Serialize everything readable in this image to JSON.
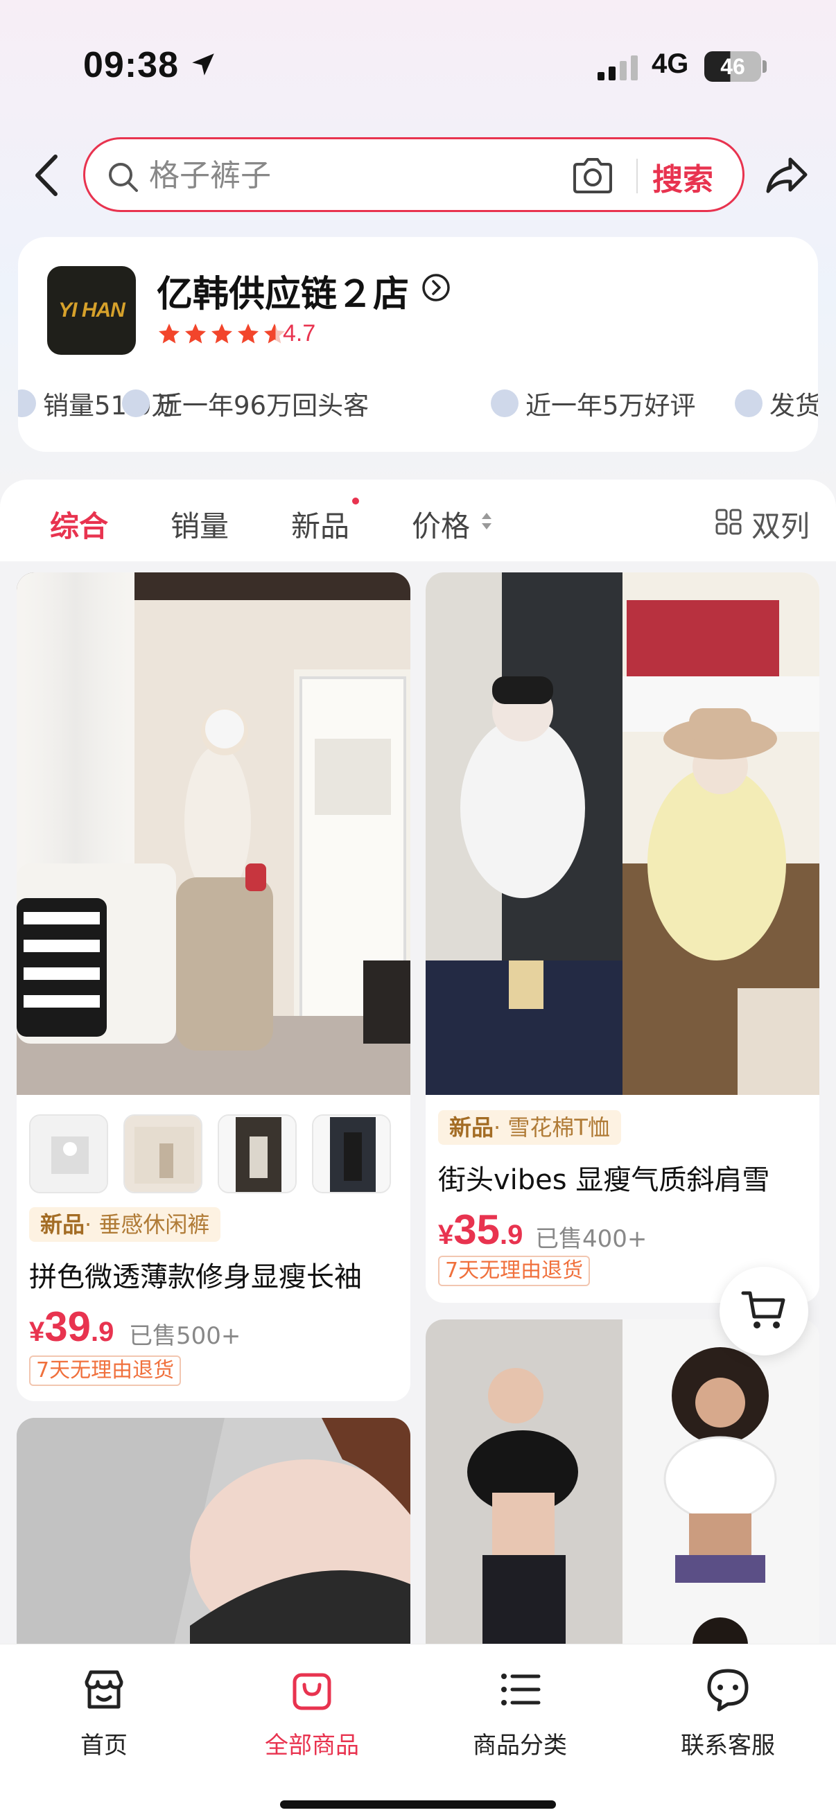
{
  "status_bar": {
    "time": "09:38",
    "network": "4G",
    "battery": "46"
  },
  "search": {
    "placeholder": "格子裤子",
    "button_label": "搜索"
  },
  "store": {
    "logo_text": "YI HAN",
    "name": "亿韩供应链２店",
    "rating": "4.7",
    "stats": [
      "销量51.0万",
      "近一年96万回头客",
      "近一年5万好评",
      "发货"
    ]
  },
  "tabs": {
    "items": [
      "综合",
      "销量",
      "新品",
      "价格"
    ],
    "active_index": 0,
    "layout_toggle": "双列"
  },
  "products": [
    {
      "tag_prefix": "新品",
      "tag_text": "· 垂感休闲裤",
      "title": "拼色微透薄款修身显瘦长袖",
      "currency": "¥",
      "price_int": "39",
      "price_dec": ".9",
      "sold": "已售500+",
      "return_policy": "7天无理由退货"
    },
    {
      "tag_prefix": "新品",
      "tag_text": "· 雪花棉T恤",
      "title": "街头vibes 显瘦气质斜肩雪",
      "currency": "¥",
      "price_int": "35",
      "price_dec": ".9",
      "sold": "已售400+",
      "return_policy": "7天无理由退货"
    }
  ],
  "bottom_nav": {
    "items": [
      "首页",
      "全部商品",
      "商品分类",
      "联系客服"
    ],
    "active_index": 1
  },
  "colors": {
    "accent": "#e8334f",
    "tag_bg": "#fdf2e2",
    "return_badge": "#f0703c"
  }
}
